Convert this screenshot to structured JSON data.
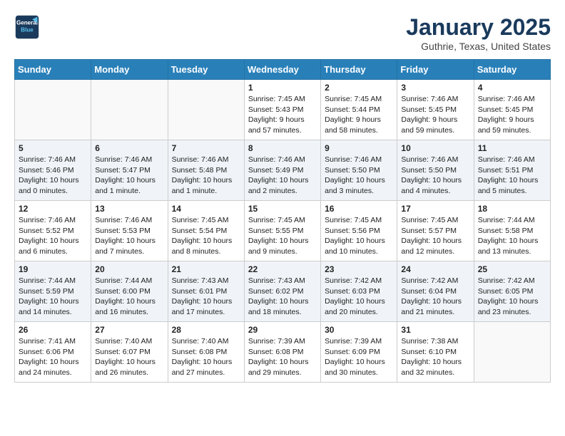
{
  "header": {
    "logo_line1": "General",
    "logo_line2": "Blue",
    "title": "January 2025",
    "subtitle": "Guthrie, Texas, United States"
  },
  "weekdays": [
    "Sunday",
    "Monday",
    "Tuesday",
    "Wednesday",
    "Thursday",
    "Friday",
    "Saturday"
  ],
  "weeks": [
    [
      {
        "day": "",
        "info": ""
      },
      {
        "day": "",
        "info": ""
      },
      {
        "day": "",
        "info": ""
      },
      {
        "day": "1",
        "info": "Sunrise: 7:45 AM\nSunset: 5:43 PM\nDaylight: 9 hours\nand 57 minutes."
      },
      {
        "day": "2",
        "info": "Sunrise: 7:45 AM\nSunset: 5:44 PM\nDaylight: 9 hours\nand 58 minutes."
      },
      {
        "day": "3",
        "info": "Sunrise: 7:46 AM\nSunset: 5:45 PM\nDaylight: 9 hours\nand 59 minutes."
      },
      {
        "day": "4",
        "info": "Sunrise: 7:46 AM\nSunset: 5:45 PM\nDaylight: 9 hours\nand 59 minutes."
      }
    ],
    [
      {
        "day": "5",
        "info": "Sunrise: 7:46 AM\nSunset: 5:46 PM\nDaylight: 10 hours\nand 0 minutes."
      },
      {
        "day": "6",
        "info": "Sunrise: 7:46 AM\nSunset: 5:47 PM\nDaylight: 10 hours\nand 1 minute."
      },
      {
        "day": "7",
        "info": "Sunrise: 7:46 AM\nSunset: 5:48 PM\nDaylight: 10 hours\nand 1 minute."
      },
      {
        "day": "8",
        "info": "Sunrise: 7:46 AM\nSunset: 5:49 PM\nDaylight: 10 hours\nand 2 minutes."
      },
      {
        "day": "9",
        "info": "Sunrise: 7:46 AM\nSunset: 5:50 PM\nDaylight: 10 hours\nand 3 minutes."
      },
      {
        "day": "10",
        "info": "Sunrise: 7:46 AM\nSunset: 5:50 PM\nDaylight: 10 hours\nand 4 minutes."
      },
      {
        "day": "11",
        "info": "Sunrise: 7:46 AM\nSunset: 5:51 PM\nDaylight: 10 hours\nand 5 minutes."
      }
    ],
    [
      {
        "day": "12",
        "info": "Sunrise: 7:46 AM\nSunset: 5:52 PM\nDaylight: 10 hours\nand 6 minutes."
      },
      {
        "day": "13",
        "info": "Sunrise: 7:46 AM\nSunset: 5:53 PM\nDaylight: 10 hours\nand 7 minutes."
      },
      {
        "day": "14",
        "info": "Sunrise: 7:45 AM\nSunset: 5:54 PM\nDaylight: 10 hours\nand 8 minutes."
      },
      {
        "day": "15",
        "info": "Sunrise: 7:45 AM\nSunset: 5:55 PM\nDaylight: 10 hours\nand 9 minutes."
      },
      {
        "day": "16",
        "info": "Sunrise: 7:45 AM\nSunset: 5:56 PM\nDaylight: 10 hours\nand 10 minutes."
      },
      {
        "day": "17",
        "info": "Sunrise: 7:45 AM\nSunset: 5:57 PM\nDaylight: 10 hours\nand 12 minutes."
      },
      {
        "day": "18",
        "info": "Sunrise: 7:44 AM\nSunset: 5:58 PM\nDaylight: 10 hours\nand 13 minutes."
      }
    ],
    [
      {
        "day": "19",
        "info": "Sunrise: 7:44 AM\nSunset: 5:59 PM\nDaylight: 10 hours\nand 14 minutes."
      },
      {
        "day": "20",
        "info": "Sunrise: 7:44 AM\nSunset: 6:00 PM\nDaylight: 10 hours\nand 16 minutes."
      },
      {
        "day": "21",
        "info": "Sunrise: 7:43 AM\nSunset: 6:01 PM\nDaylight: 10 hours\nand 17 minutes."
      },
      {
        "day": "22",
        "info": "Sunrise: 7:43 AM\nSunset: 6:02 PM\nDaylight: 10 hours\nand 18 minutes."
      },
      {
        "day": "23",
        "info": "Sunrise: 7:42 AM\nSunset: 6:03 PM\nDaylight: 10 hours\nand 20 minutes."
      },
      {
        "day": "24",
        "info": "Sunrise: 7:42 AM\nSunset: 6:04 PM\nDaylight: 10 hours\nand 21 minutes."
      },
      {
        "day": "25",
        "info": "Sunrise: 7:42 AM\nSunset: 6:05 PM\nDaylight: 10 hours\nand 23 minutes."
      }
    ],
    [
      {
        "day": "26",
        "info": "Sunrise: 7:41 AM\nSunset: 6:06 PM\nDaylight: 10 hours\nand 24 minutes."
      },
      {
        "day": "27",
        "info": "Sunrise: 7:40 AM\nSunset: 6:07 PM\nDaylight: 10 hours\nand 26 minutes."
      },
      {
        "day": "28",
        "info": "Sunrise: 7:40 AM\nSunset: 6:08 PM\nDaylight: 10 hours\nand 27 minutes."
      },
      {
        "day": "29",
        "info": "Sunrise: 7:39 AM\nSunset: 6:08 PM\nDaylight: 10 hours\nand 29 minutes."
      },
      {
        "day": "30",
        "info": "Sunrise: 7:39 AM\nSunset: 6:09 PM\nDaylight: 10 hours\nand 30 minutes."
      },
      {
        "day": "31",
        "info": "Sunrise: 7:38 AM\nSunset: 6:10 PM\nDaylight: 10 hours\nand 32 minutes."
      },
      {
        "day": "",
        "info": ""
      }
    ]
  ]
}
